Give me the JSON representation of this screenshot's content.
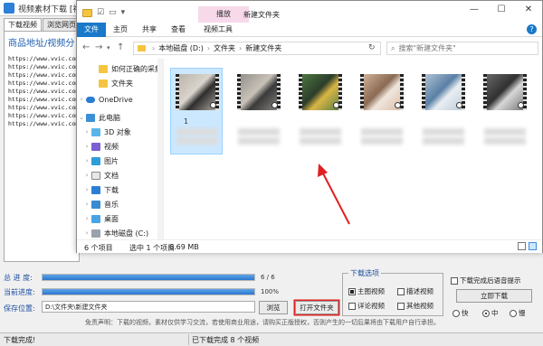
{
  "app": {
    "title": "视频素材下载 [视频下载高手]",
    "tabs": [
      "下载视频",
      "浏览网页"
    ],
    "panel_heading": "商品地址/视频分",
    "url_lines": "https://www.vvic.com\nhttps://www.vvic.com\nhttps://www.vvic.com\nhttps://www.vvic.com\nhttps://www.vvic.com\nhttps://www.vvic.com\nhttps://www.vvic.com\nhttps://www.vvic.com\nhttps://www.vvic.com",
    "total_progress_label": "总 进 度:",
    "total_progress_text": "6 / 6",
    "total_progress_fraction": 1.0,
    "current_progress_label": "当前进度:",
    "current_progress_text": "100%",
    "current_progress_fraction": 1.0,
    "save_location_label": "保存位置:",
    "save_location_value": "D:\\文件夹\\新建文件夹",
    "browse_button": "浏览",
    "open_folder_button": "打开文件夹",
    "download_options_legend": "下载选项",
    "options": [
      {
        "label": "主图视频",
        "checked": true
      },
      {
        "label": "描述视频",
        "checked": false
      },
      {
        "label": "详论视频",
        "checked": false
      },
      {
        "label": "其他视频",
        "checked": false
      }
    ],
    "voice_prompt_label": "下载完成后语音提示",
    "voice_prompt_checked": false,
    "download_now_button": "立即下载",
    "speed_options": [
      {
        "label": "快",
        "selected": false
      },
      {
        "label": "中",
        "selected": true
      },
      {
        "label": "慢",
        "selected": false
      }
    ],
    "disclaimer": "免责声明：下载的视频，素材仅供学习交流，若使用商业用途，请购买正版授权，否则产生的一切后果将由下载用户自行承担。",
    "status_left": "下载完成!",
    "status_right": "已下载完成 8 个视频",
    "accent_color": "#2a78d0",
    "highlight_color": "#e02020"
  },
  "explorer": {
    "context_tab": "播放",
    "window_title": "新建文件夹",
    "window_buttons": [
      "—",
      "☐",
      "✕"
    ],
    "ribbon_tabs": [
      "文件",
      "主页",
      "共享",
      "查看",
      "视频工具"
    ],
    "address": [
      "本地磁盘 (D:)",
      "文件夹",
      "新建文件夹"
    ],
    "search_placeholder": "搜索\"新建文件夹\"",
    "nav": [
      {
        "label": "如何正确的采集",
        "icon": "folder"
      },
      {
        "label": "文件夹",
        "icon": "folder"
      },
      {
        "label": "OneDrive",
        "icon": "onedrive"
      },
      {
        "label": "此电脑",
        "icon": "pc"
      },
      {
        "label": "3D 对象",
        "icon": "obj3d"
      },
      {
        "label": "视频",
        "icon": "video"
      },
      {
        "label": "图片",
        "icon": "pic"
      },
      {
        "label": "文档",
        "icon": "doc"
      },
      {
        "label": "下载",
        "icon": "dl"
      },
      {
        "label": "音乐",
        "icon": "music"
      },
      {
        "label": "桌面",
        "icon": "desk"
      },
      {
        "label": "本地磁盘 (C:)",
        "icon": "disk"
      },
      {
        "label": "本地磁盘 (D:)",
        "icon": "disk"
      }
    ],
    "thumbnails": [
      {
        "label": "1",
        "colors": [
          "#b7b0a6",
          "#2d2d2d",
          "#d9d4cc"
        ],
        "selected": true
      },
      {
        "label": "",
        "colors": [
          "#8e8a85",
          "#3a3a3a",
          "#c8c2b8"
        ],
        "selected": false
      },
      {
        "label": "",
        "colors": [
          "#4f7d44",
          "#d9b545",
          "#2c3d2a"
        ],
        "selected": false
      },
      {
        "label": "",
        "colors": [
          "#d8b9a2",
          "#f0e6dc",
          "#8a6a52"
        ],
        "selected": false
      },
      {
        "label": "",
        "colors": [
          "#b9c9d8",
          "#e9eef2",
          "#5a7fa5"
        ],
        "selected": false
      },
      {
        "label": "",
        "colors": [
          "#6e6e6e",
          "#d7d7d7",
          "#303030"
        ],
        "selected": false
      }
    ],
    "status_count": "6 个项目",
    "status_selected": "选中 1 个项目",
    "status_size": "6.69 MB"
  }
}
